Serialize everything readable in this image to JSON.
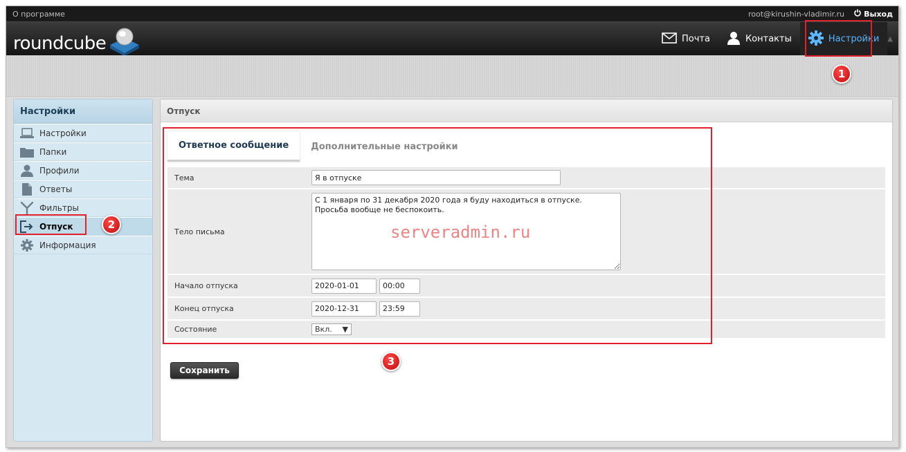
{
  "topbar": {
    "about": "О программе",
    "user": "root@kirushin-vladimir.ru",
    "logout": "Выход"
  },
  "logo": {
    "text": "roundcube"
  },
  "nav": {
    "mail": "Почта",
    "contacts": "Контакты",
    "settings": "Настройки"
  },
  "sidebar": {
    "title": "Настройки",
    "items": [
      {
        "label": "Настройки",
        "icon": "laptop-icon"
      },
      {
        "label": "Папки",
        "icon": "folder-icon"
      },
      {
        "label": "Профили",
        "icon": "user-icon"
      },
      {
        "label": "Ответы",
        "icon": "document-icon"
      },
      {
        "label": "Фильтры",
        "icon": "filter-icon"
      },
      {
        "label": "Отпуск",
        "icon": "exit-icon",
        "selected": true
      },
      {
        "label": "Информация",
        "icon": "gear-icon"
      }
    ]
  },
  "main": {
    "title": "Отпуск",
    "tabs": [
      "Ответное сообщение",
      "Дополнительные настройки"
    ],
    "form": {
      "subject_label": "Тема",
      "subject_value": "Я в отпуске",
      "body_label": "Тело письма",
      "body_value": "С 1 января по 31 декабря 2020 года я буду находиться в отпуске. Просьба вообще не беспокоить.",
      "start_label": "Начало отпуска",
      "start_date": "2020-01-01",
      "start_time": "00:00",
      "end_label": "Конец отпуска",
      "end_date": "2020-12-31",
      "end_time": "23:59",
      "status_label": "Состояние",
      "status_value": "Вкл."
    },
    "save": "Сохранить"
  },
  "annotations": {
    "badge1": "1",
    "badge2": "2",
    "badge3": "3",
    "watermark": "serveradmin.ru"
  },
  "colors": {
    "accent": "#5bb6ff",
    "highlight": "#e0202a"
  }
}
